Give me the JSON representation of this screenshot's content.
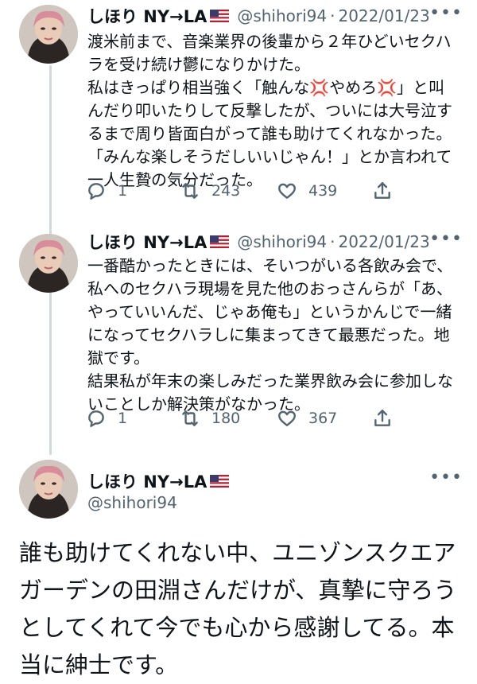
{
  "tweets": [
    {
      "name": "しほり NY→LA",
      "handle": "@shihori94",
      "dot": "·",
      "date": "2022/01/23",
      "more": "•••",
      "text": "渡米前まで、音楽業界の後輩から２年ひどいセクハラを受け続け鬱になりかけた。\n私はきっぱり相当強く「触んな💢やめろ💢」と叫んだり叩いたりして反撃したが、ついには大号泣するまで周り皆面白がって誰も助けてくれなかった。「みんな楽しそうだしいいじゃん！」とか言われて一人生贄の気分だった。",
      "replies": "1",
      "retweets": "243",
      "likes": "439"
    },
    {
      "name": "しほり NY→LA",
      "handle": "@shihori94",
      "dot": "·",
      "date": "2022/01/23",
      "more": "•••",
      "text": "一番酷かったときには、そいつがいる各飲み会で、私へのセクハラ現場を見た他のおっさんらが「あ、やっていいんだ、じゃあ俺も」というかんじで一緒になってセクハラしに集まってきて最悪だった。地獄です。\n結果私が年末の楽しみだった業界飲み会に参加しないことしか解決策がなかった。",
      "replies": "1",
      "retweets": "180",
      "likes": "367"
    }
  ],
  "main_tweet": {
    "name": "しほり NY→LA",
    "handle": "@shihori94",
    "more": "•••",
    "text": "誰も助けてくれない中、ユニゾンスクエアガーデンの田淵さんだけが、真摯に守ろうとしてくれて今でも心から感謝してる。本当に紳士です。"
  },
  "icons": [
    "reply-icon",
    "retweet-icon",
    "like-icon",
    "share-icon",
    "us-flag-icon",
    "more-icon"
  ],
  "colors": {
    "text": "#0f1419",
    "secondary": "#536471",
    "thread_line": "#cfd9de"
  }
}
